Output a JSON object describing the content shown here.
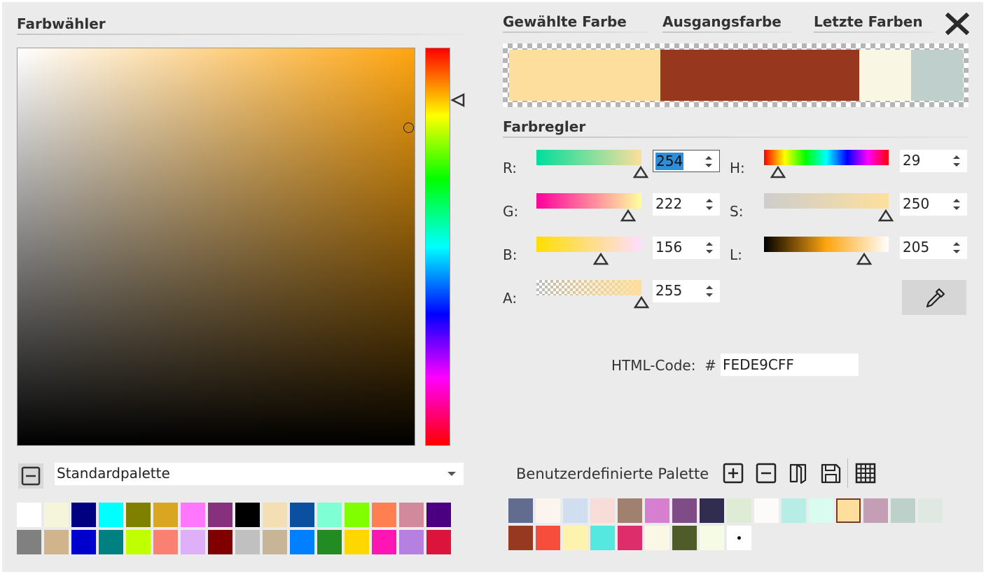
{
  "picker": {
    "title": "Farbwähler",
    "hue_color": "#ffa50f"
  },
  "tabs": {
    "selected": "Gewählte Farbe",
    "original": "Ausgangsfarbe",
    "recent": "Letzte Farben",
    "close_icon": "close-x-icon"
  },
  "preview": {
    "selected_color": "#fede9c",
    "original_color": "#96371e",
    "recent_colors": [
      "#faf6e4",
      "#bfd0cc"
    ]
  },
  "sliders": {
    "title": "Farbregler",
    "R": {
      "label": "R:",
      "value": "254",
      "level": 0.996
    },
    "G": {
      "label": "G:",
      "value": "222",
      "level": 0.871
    },
    "B": {
      "label": "B:",
      "value": "156",
      "level": 0.612
    },
    "A": {
      "label": "A:",
      "value": "255",
      "level": 1.0
    },
    "H": {
      "label": "H:",
      "value": "29",
      "level": 0.114
    },
    "S": {
      "label": "S:",
      "value": "250",
      "level": 0.98
    },
    "L": {
      "label": "L:",
      "value": "205",
      "level": 0.804
    }
  },
  "eyedropper": {
    "icon": "eyedropper-icon"
  },
  "html_code": {
    "label": "HTML-Code:  #",
    "value": "FEDE9CFF"
  },
  "standard_palette": {
    "collapse_icon": "minus-icon",
    "selected": "Standardpalette",
    "colors": [
      "#ffffff",
      "#f5f5dc",
      "#000080",
      "#00ffff",
      "#808000",
      "#daa520",
      "#ff77ff",
      "#86307e",
      "#000000",
      "#f4deb3",
      "#0a4fa0",
      "#7fffd4",
      "#7fff00",
      "#ff7f50",
      "#d08a9c",
      "#4b0082",
      "#808080",
      "#d2b48c",
      "#0000cd",
      "#008080",
      "#bfff00",
      "#fa8072",
      "#ddb0f8",
      "#800000",
      "#c0c0c0",
      "#c8b496",
      "#0080ff",
      "#228b22",
      "#ffd700",
      "#ff14b4",
      "#b580e0",
      "#dc143c"
    ]
  },
  "custom_palette": {
    "title": "Benutzerdefinierte Palette",
    "tool_icons": [
      "add-icon",
      "remove-icon",
      "open-file-icon",
      "save-icon",
      "grid-icon"
    ],
    "row1": [
      "#616c8f",
      "#fcf4ee",
      "#d1deef",
      "#f8dcd8",
      "#a08170",
      "#d67fd0",
      "#7f4c88",
      "#312d51",
      "#dfecd5",
      "#fdfbfa",
      "#b8ede5",
      "#d8fdf0",
      "#fede9c",
      "#c49eb4",
      "#bed0ca",
      "#dfe8e1"
    ],
    "row2": [
      "#973821",
      "#f74d3d",
      "#fdf2ae",
      "#54e8e1",
      "#dd2e6b",
      "#fbf7e6",
      "#4f5b29",
      "#f5fbe5",
      "#ffffff"
    ]
  }
}
